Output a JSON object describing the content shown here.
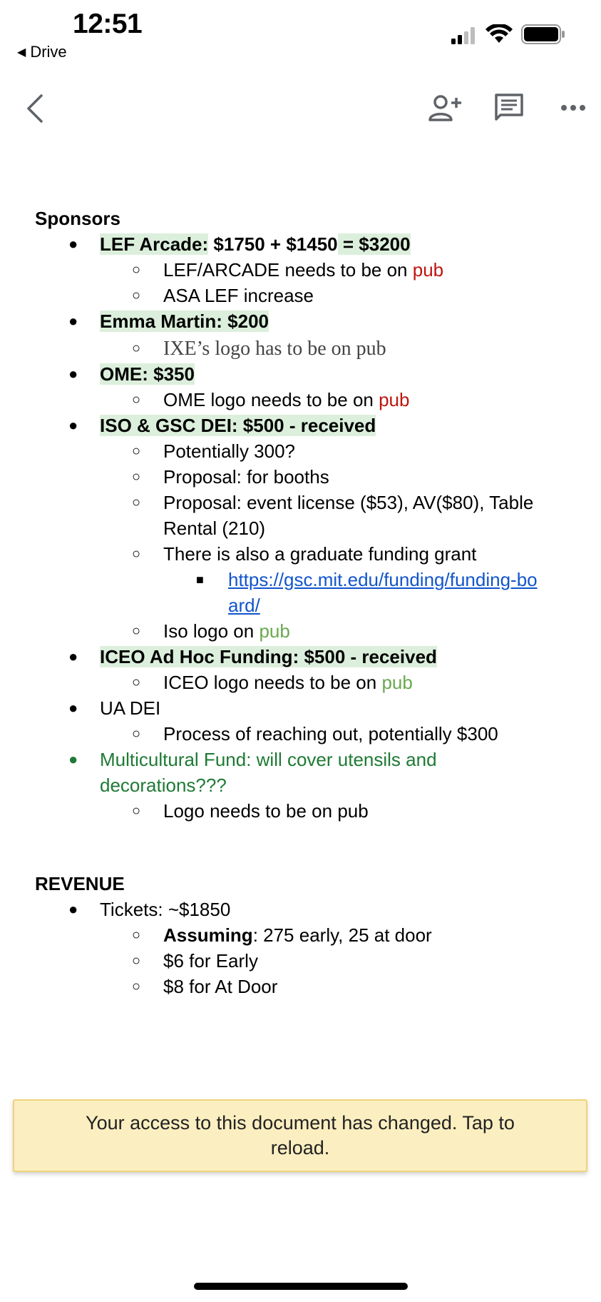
{
  "status_bar": {
    "time": "12:51",
    "back_label": "Drive"
  },
  "toolbar": {
    "back_icon": "chevron-left-icon",
    "share_icon": "add-person-icon",
    "comment_icon": "comment-icon",
    "more_icon": "more-horiz-icon"
  },
  "sponsors": {
    "heading": "Sponsors",
    "lef": {
      "a": "LEF Arcade:",
      "b": " $1750 + $1450",
      "c": " = $3200"
    },
    "lef_subs": [
      {
        "text": "LEF/ARCADE needs to be on ",
        "pub": "pub"
      },
      {
        "text": "ASA LEF increase"
      }
    ],
    "emma": "Emma Martin: $200",
    "emma_sub": {
      "text": "IXE’s logo has to be on ",
      "pub": "pub"
    },
    "ome": "OME: $350",
    "ome_sub": {
      "text": "OME logo needs to be on ",
      "pub": "pub"
    },
    "iso": "ISO & GSC DEI: $500 - received",
    "iso_subs": [
      "Potentially 300?",
      "Proposal: for booths",
      "Proposal: event license ($53), AV($80), Table",
      "Rental (210)",
      "There is also a graduate funding grant"
    ],
    "iso_link": [
      "https://gsc.mit.edu/funding/funding-bo",
      "ard/"
    ],
    "iso_logo": {
      "text": "Iso logo on ",
      "pub": "pub"
    },
    "iceo": "ICEO Ad Hoc Funding: $500 - received",
    "iceo_sub": {
      "text": "ICEO logo needs to be on ",
      "pub": "pub"
    },
    "ua": "UA DEI",
    "ua_sub": "Process of reaching out, potentially $300",
    "multi": [
      "Multicultural Fund: will cover utensils and",
      "decorations???"
    ],
    "multi_sub": "Logo needs to be on pub"
  },
  "revenue": {
    "heading": "REVENUE",
    "tickets": "Tickets: ~$1850",
    "assuming_label": "Assuming",
    "assuming_text": ": 275 early, 25 at door",
    "early": "$6 for Early",
    "door": "$8 for At Door"
  },
  "banner": {
    "text": "Your access to this document has changed. Tap to reload."
  }
}
